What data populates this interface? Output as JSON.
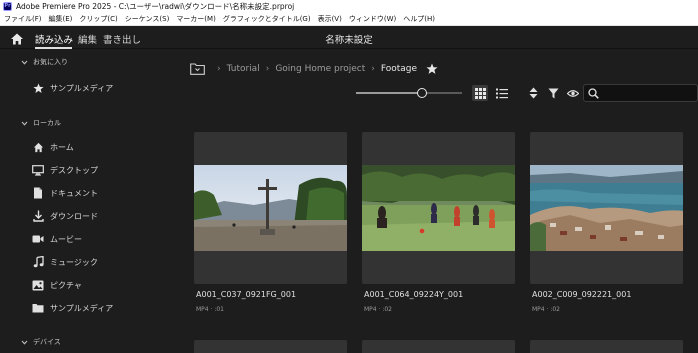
{
  "window": {
    "title": "Adobe Premiere Pro 2025 - C:\\ユーザー\\radwi\\ダウンロード\\名称未設定.prproj",
    "app_icon_label": "Pr"
  },
  "menu": [
    "ファイル(F)",
    "編集(E)",
    "クリップ(C)",
    "シーケンス(S)",
    "マーカー(M)",
    "グラフィックとタイトル(G)",
    "表示(V)",
    "ウィンドウ(W)",
    "ヘルプ(H)"
  ],
  "workspace": {
    "tabs": [
      "読み込み",
      "編集",
      "書き出し"
    ],
    "active_tab": "読み込み",
    "project_name": "名称未設定"
  },
  "sidebar": {
    "favorites_header": "お気に入り",
    "favorites": [
      {
        "label": "サンプルメディア",
        "icon": "star-icon"
      }
    ],
    "local_header": "ローカル",
    "local": [
      {
        "label": "ホーム",
        "icon": "home-icon"
      },
      {
        "label": "デスクトップ",
        "icon": "monitor-icon"
      },
      {
        "label": "ドキュメント",
        "icon": "document-icon"
      },
      {
        "label": "ダウンロード",
        "icon": "download-icon"
      },
      {
        "label": "ムービー",
        "icon": "video-camera-icon"
      },
      {
        "label": "ミュージック",
        "icon": "music-note-icon"
      },
      {
        "label": "ピクチャ",
        "icon": "picture-icon"
      },
      {
        "label": "サンプルメディア",
        "icon": "folder-icon"
      }
    ],
    "devices_header": "デバイス"
  },
  "breadcrumb": [
    "Tutorial",
    "Going Home project",
    "Footage"
  ],
  "toolbar": {
    "zoom_level": 0.6,
    "view_mode": "grid",
    "search_placeholder": ""
  },
  "clips": [
    {
      "name": "A001_C037_0921FG_001",
      "meta": "MP4 · :01",
      "scene": "cross-plaza"
    },
    {
      "name": "A001_C064_09224Y_001",
      "meta": "MP4 · :02",
      "scene": "soccer-field"
    },
    {
      "name": "A002_C009_092221_001",
      "meta": "MP4 · :02",
      "scene": "lake-town"
    }
  ],
  "colors": {
    "background": "#1d1d1d",
    "card": "#333333",
    "text": "#e0e0e0",
    "muted": "#9a9a9a"
  }
}
